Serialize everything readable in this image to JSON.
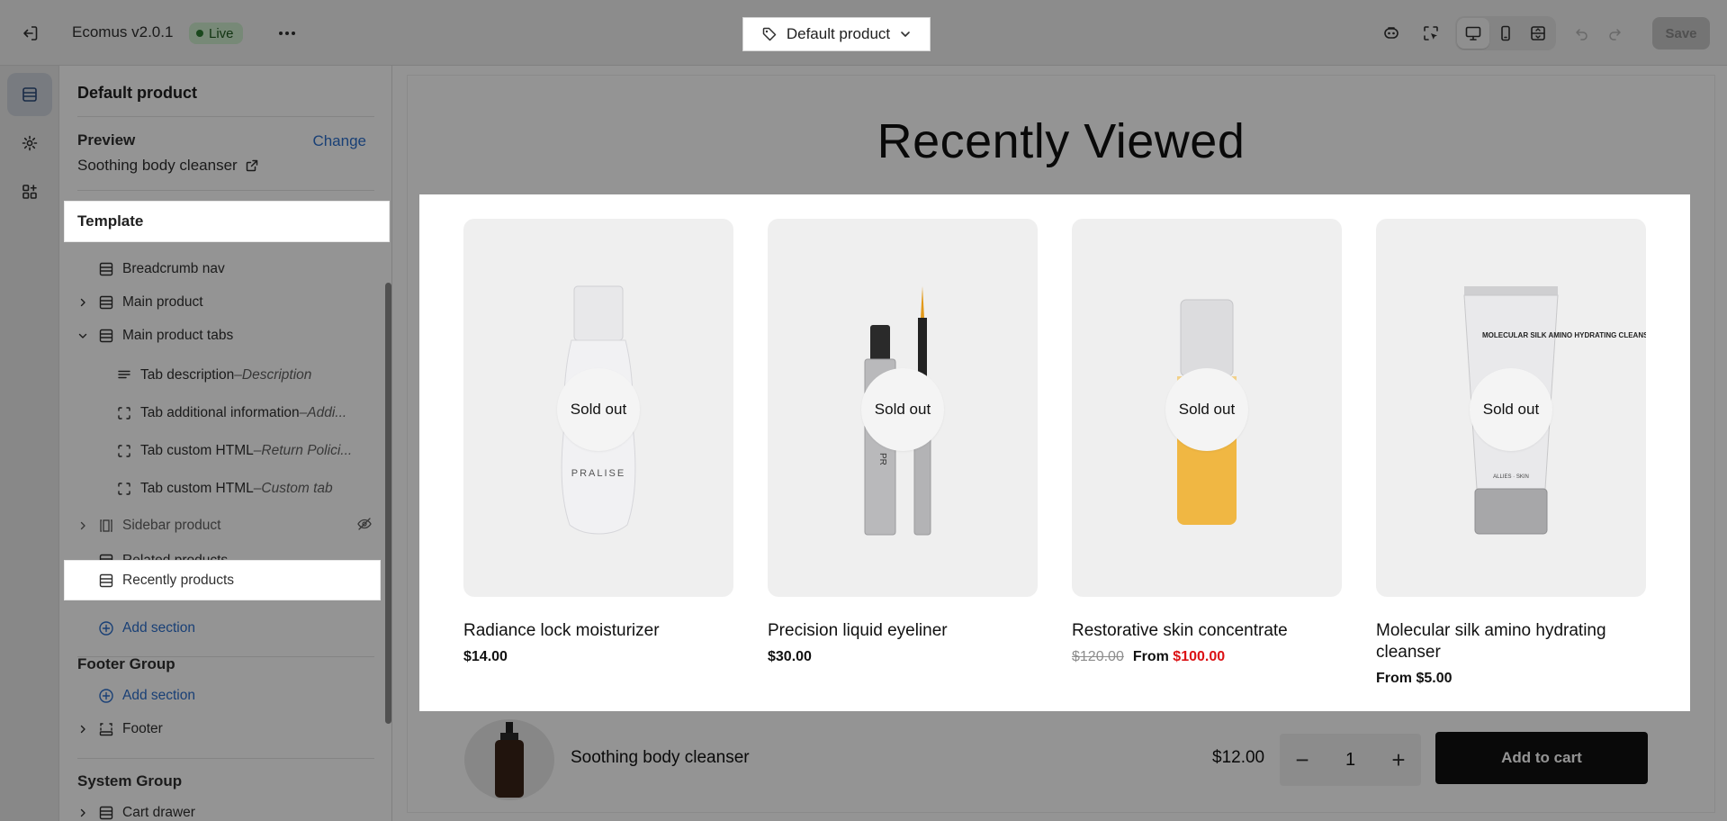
{
  "topbar": {
    "app_title": "Ecomus v2.0.1",
    "status_badge": "Live",
    "template_select": "Default product",
    "save_label": "Save"
  },
  "sidebar": {
    "title": "Default product",
    "preview_label": "Preview",
    "change_label": "Change",
    "preview_product": "Soothing body cleanser",
    "template_label": "Template",
    "items": [
      {
        "label": "Breadcrumb nav",
        "suffix": ""
      },
      {
        "label": "Main product",
        "suffix": ""
      },
      {
        "label": "Main product tabs",
        "suffix": ""
      },
      {
        "label": "Tab description",
        "suffix": "Description"
      },
      {
        "label": "Tab additional information",
        "suffix": "Addi..."
      },
      {
        "label": "Tab custom HTML",
        "suffix": "Return Polici..."
      },
      {
        "label": "Tab custom HTML",
        "suffix": "Custom tab"
      },
      {
        "label": "Sidebar product",
        "suffix": ""
      },
      {
        "label": "Related products",
        "suffix": ""
      },
      {
        "label": "Recently products",
        "suffix": ""
      }
    ],
    "add_section": "Add section",
    "separator": " – ",
    "footer_group": {
      "title": "Footer Group",
      "add_section": "Add section",
      "items": [
        {
          "label": "Footer"
        }
      ]
    },
    "system_group": {
      "title": "System Group",
      "items": [
        {
          "label": "Cart drawer"
        }
      ]
    }
  },
  "preview": {
    "section_title": "Recently Viewed",
    "sold_out_label": "Sold out",
    "products": [
      {
        "name": "Radiance lock moisturizer",
        "price": "$14.00",
        "old_price": "",
        "prefix": "",
        "sale_price": ""
      },
      {
        "name": "Precision liquid eyeliner",
        "price": "$30.00",
        "old_price": "",
        "prefix": "",
        "sale_price": ""
      },
      {
        "name": "Restorative skin concentrate",
        "price": "",
        "old_price": "$120.00",
        "prefix": "From ",
        "sale_price": "$100.00"
      },
      {
        "name": "Molecular silk amino hydrating cleanser",
        "price": "From $5.00",
        "old_price": "",
        "prefix": "",
        "sale_price": ""
      }
    ],
    "product_labels": {
      "p1_brand": "PRALISE",
      "p4_tube": "MOLECULAR SILK AMINO HYDRATING CLEANSER",
      "p4_brand": "ALLIES · SKIN"
    },
    "sticky": {
      "name": "Soothing body cleanser",
      "price": "$12.00",
      "quantity": "1",
      "minus": "−",
      "plus": "+",
      "add_to_cart": "Add to cart"
    }
  },
  "colors": {
    "accent_link": "#2c6ecb",
    "live_badge_bg": "#cdeccd",
    "sale_red": "#db1215",
    "button_black": "#111111"
  }
}
